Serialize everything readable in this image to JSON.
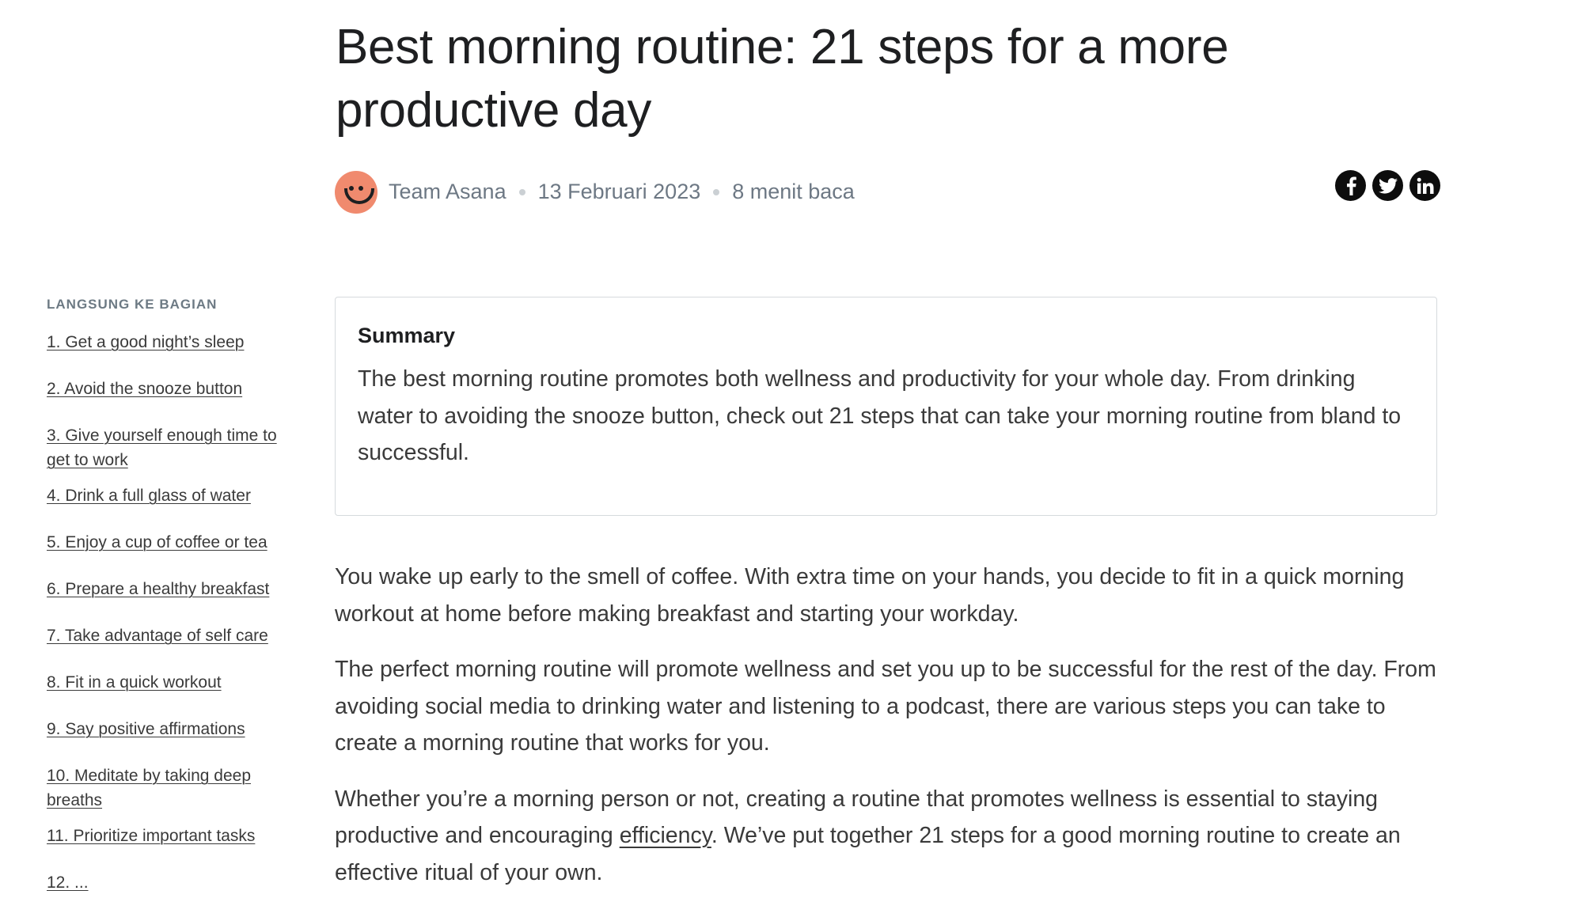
{
  "article": {
    "title": "Best morning routine: 21 steps for a more productive day",
    "author": "Team Asana",
    "date": "13 Februari 2023",
    "read_time": "8 menit baca",
    "avatar_color": "#F08A6E"
  },
  "social": [
    {
      "name": "facebook-icon",
      "label": "f"
    },
    {
      "name": "twitter-icon",
      "label": "twitter"
    },
    {
      "name": "linkedin-icon",
      "label": "in"
    }
  ],
  "toc": {
    "header": "LANGSUNG KE BAGIAN",
    "items": [
      "1. Get a good night’s sleep",
      "2. Avoid the snooze button",
      "3. Give yourself enough time to get to work",
      "4. Drink a full glass of water",
      "5. Enjoy a cup of coffee or tea",
      "6. Prepare a healthy breakfast",
      "7. Take advantage of self care",
      "8. Fit in a quick workout",
      "9. Say positive affirmations",
      "10. Meditate by taking deep breaths",
      "11. Prioritize important tasks",
      "12. ..."
    ]
  },
  "summary": {
    "heading": "Summary",
    "text": "The best morning routine promotes both wellness and productivity for your whole day. From drinking water to avoiding the snooze button, check out 21 steps that can take your morning routine from bland to successful."
  },
  "body": {
    "p1": "You wake up early to the smell of coffee. With extra time on your hands, you decide to fit in a quick morning workout at home before making breakfast and starting your workday.",
    "p2": "The perfect morning routine will promote wellness and set you up to be successful for the rest of the day. From avoiding social media to drinking water and listening to a podcast, there are various steps you can take to create a morning routine that works for you.",
    "p3_before": "Whether you’re a morning person or not, creating a routine that promotes wellness is essential to staying productive and encouraging ",
    "p3_link": "efficiency",
    "p3_after": ". We’ve put together 21 steps for a good morning routine to create an effective ritual of your own."
  }
}
